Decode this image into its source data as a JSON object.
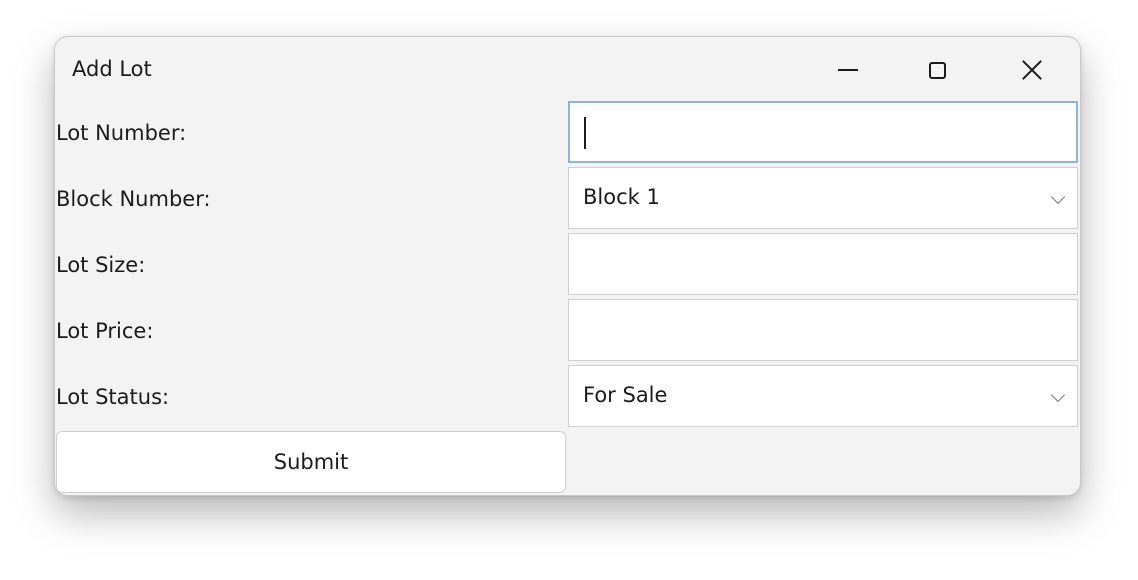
{
  "window": {
    "title": "Add Lot",
    "controls": {
      "minimize": "minimize-icon",
      "maximize": "maximize-icon",
      "close": "close-icon"
    }
  },
  "form": {
    "lot_number": {
      "label": "Lot Number:",
      "value": ""
    },
    "block_number": {
      "label": "Block Number:",
      "selected": "Block 1"
    },
    "lot_size": {
      "label": "Lot Size:",
      "value": ""
    },
    "lot_price": {
      "label": "Lot Price:",
      "value": ""
    },
    "lot_status": {
      "label": "Lot Status:",
      "selected": "For Sale"
    },
    "submit_label": "Submit"
  },
  "colors": {
    "window_bg": "#f3f3f3",
    "focus_border": "#8fb4dc",
    "field_bg": "#ffffff"
  }
}
